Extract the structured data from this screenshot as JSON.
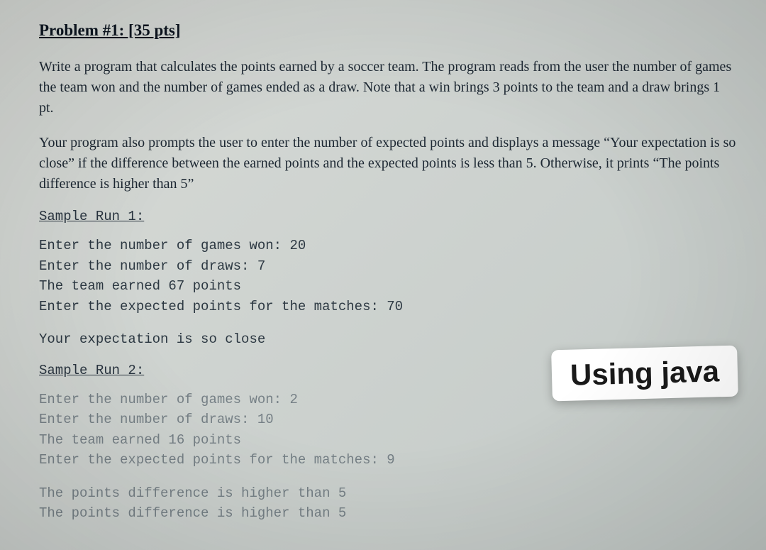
{
  "title": "Problem #1: [35 pts]",
  "paragraph1": "Write a program that calculates the points earned by a soccer team. The program reads from the user the number of games the team won and the number of games ended as a draw. Note that a win brings 3 points to the team and a draw brings 1 pt.",
  "paragraph2": "Your program also prompts the user to enter the number of expected points and displays a message “Your expectation is so close” if the difference between the earned points and the expected points is less than 5. Otherwise, it prints “The points difference is higher than 5”",
  "sample1_heading": "Sample Run 1:",
  "sample1_block1": "Enter the number of games won: 20\nEnter the number of draws: 7\nThe team earned 67 points\nEnter the expected points for the matches: 70",
  "sample1_block2": "Your expectation is so close",
  "sample2_heading": "Sample Run 2:",
  "sample2_block1": "Enter the number of games won: 2\nEnter the number of draws: 10\nThe team earned 16 points\nEnter the expected points for the matches: 9",
  "sample2_block2": "The points difference is higher than 5\nThe points difference is higher than 5",
  "note": "Using java"
}
